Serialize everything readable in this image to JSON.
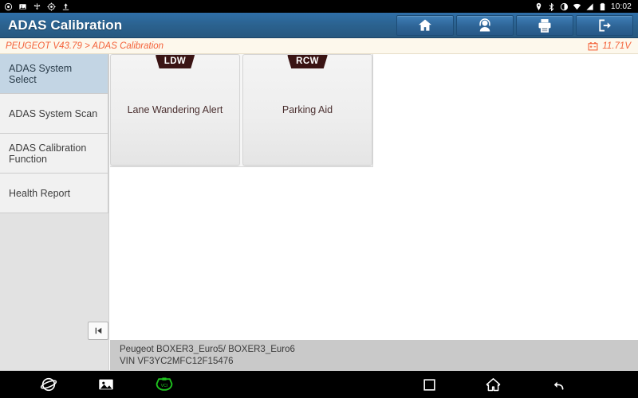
{
  "statusbar": {
    "left_icons": [
      "dialer-icon",
      "screenshot-icon",
      "usb-icon",
      "settings-gear-icon",
      "upload-icon"
    ],
    "right_icons": [
      "location-pin-icon",
      "bluetooth-icon",
      "do-not-disturb-icon",
      "wifi-icon",
      "cellular-signal-icon",
      "battery-icon"
    ],
    "clock": "10:02"
  },
  "titlebar": {
    "title": "ADAS Calibration",
    "buttons": [
      {
        "name": "home-button",
        "icon": "home-icon"
      },
      {
        "name": "support-button",
        "icon": "headset-person-icon"
      },
      {
        "name": "print-button",
        "icon": "printer-icon"
      },
      {
        "name": "exit-button",
        "icon": "exit-door-icon"
      }
    ]
  },
  "breadcrumb": {
    "text": "PEUGEOT V43.79 > ADAS Calibration",
    "voltage": "11.71V",
    "voltage_icon": "car-battery-icon",
    "accent_color": "#f4623a"
  },
  "sidebar": {
    "items": [
      {
        "label": "ADAS System Select",
        "selected": true
      },
      {
        "label": "ADAS System Scan",
        "selected": false
      },
      {
        "label": "ADAS Calibration Function",
        "selected": false
      },
      {
        "label": "Health Report",
        "selected": false
      }
    ],
    "collapse_button": {
      "name": "collapse-sidebar-button",
      "icon": "skip-to-start-icon"
    },
    "selected_color": "#c3d5e4"
  },
  "content": {
    "cards": [
      {
        "badge": "LDW",
        "label": "Lane Wandering Alert"
      },
      {
        "badge": "RCW",
        "label": "Parking Aid"
      }
    ],
    "badge_color": "#3a1414"
  },
  "vehicle_info": {
    "model": "Peugeot BOXER3_Euro5/ BOXER3_Euro6",
    "vin": "VIN VF3YC2MFC12F15476"
  },
  "navbar": {
    "left_icons": [
      "browser-icon",
      "gallery-icon",
      "vci-connection-icon"
    ],
    "right_icons": [
      "recents-square-icon",
      "home-icon",
      "back-arrow-icon"
    ],
    "vci_color": "#1fc21f"
  }
}
